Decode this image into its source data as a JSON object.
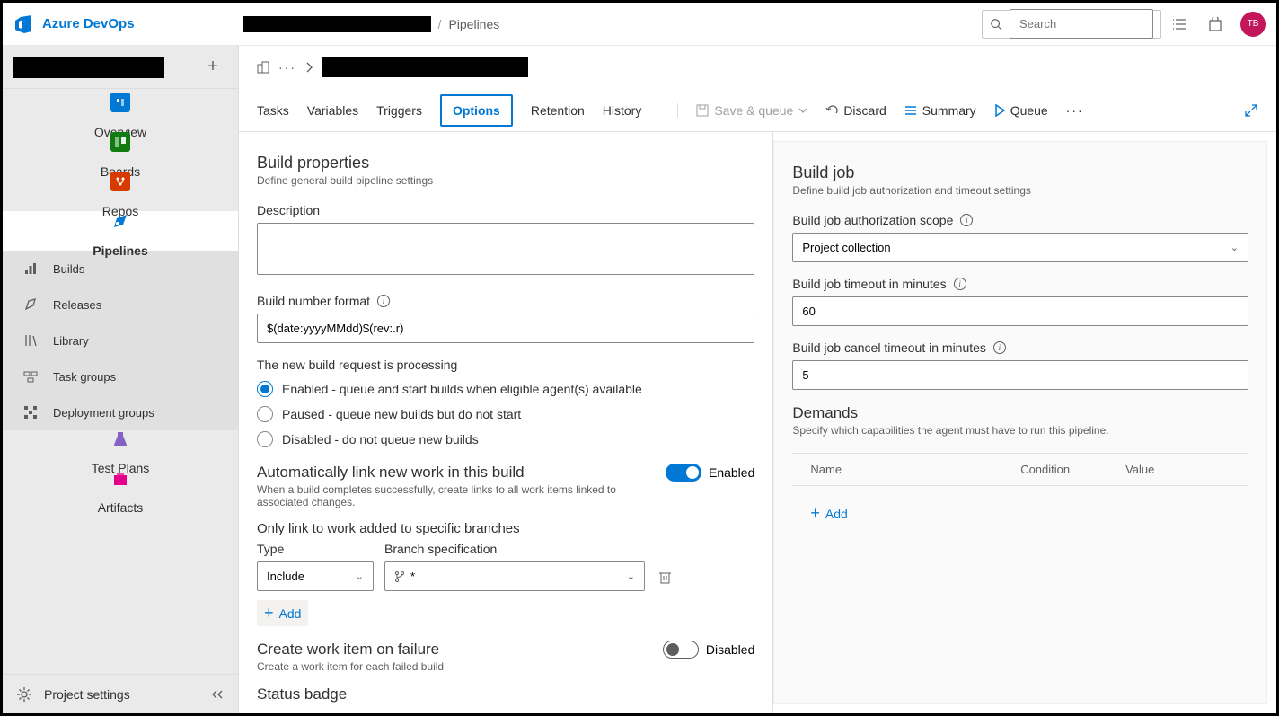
{
  "header": {
    "product": "Azure DevOps",
    "breadcrumb_last": "Pipelines",
    "search_placeholder": "Search",
    "avatar_initials": "TB"
  },
  "sidebar": {
    "items": [
      {
        "label": "Overview",
        "icon": "overview",
        "color": "#0078d4"
      },
      {
        "label": "Boards",
        "icon": "boards",
        "color": "#107c10"
      },
      {
        "label": "Repos",
        "icon": "repos",
        "color": "#d83b01"
      },
      {
        "label": "Pipelines",
        "icon": "pipelines",
        "color": "#0078d4",
        "selected": true
      },
      {
        "label": "Test Plans",
        "icon": "test",
        "color": "#8661c5"
      },
      {
        "label": "Artifacts",
        "icon": "artifacts",
        "color": "#e3008c"
      }
    ],
    "sub_items": [
      {
        "label": "Builds"
      },
      {
        "label": "Releases"
      },
      {
        "label": "Library"
      },
      {
        "label": "Task groups"
      },
      {
        "label": "Deployment groups"
      }
    ],
    "settings_label": "Project settings"
  },
  "tabs": [
    "Tasks",
    "Variables",
    "Triggers",
    "Options",
    "Retention",
    "History"
  ],
  "tab_selected": "Options",
  "toolbar": {
    "save_queue": "Save & queue",
    "discard": "Discard",
    "summary": "Summary",
    "queue": "Queue"
  },
  "left": {
    "heading": "Build properties",
    "subtitle": "Define general build pipeline settings",
    "description_label": "Description",
    "description_value": "",
    "bnf_label": "Build number format",
    "bnf_value": "$(date:yyyyMMdd)$(rev:.r)",
    "processing_label": "The new build request is processing",
    "radios": [
      "Enabled - queue and start builds when eligible agent(s) available",
      "Paused - queue new builds but do not start",
      "Disabled - do not queue new builds"
    ],
    "autolink_heading": "Automatically link new work in this build",
    "autolink_sub": "When a build completes successfully, create links to all work items linked to associated changes.",
    "autolink_state": "Enabled",
    "branches_label": "Only link to work added to specific branches",
    "type_label": "Type",
    "type_value": "Include",
    "branch_spec_label": "Branch specification",
    "branch_spec_value": "*",
    "add_label": "Add",
    "wi_fail_heading": "Create work item on failure",
    "wi_fail_sub": "Create a work item for each failed build",
    "wi_fail_state": "Disabled",
    "status_badge_heading": "Status badge"
  },
  "right": {
    "heading": "Build job",
    "subtitle": "Define build job authorization and timeout settings",
    "auth_label": "Build job authorization scope",
    "auth_value": "Project collection",
    "timeout_label": "Build job timeout in minutes",
    "timeout_value": "60",
    "cancel_label": "Build job cancel timeout in minutes",
    "cancel_value": "5",
    "demands_heading": "Demands",
    "demands_sub": "Specify which capabilities the agent must have to run this pipeline.",
    "cols": {
      "name": "Name",
      "cond": "Condition",
      "val": "Value"
    },
    "add_label": "Add"
  }
}
